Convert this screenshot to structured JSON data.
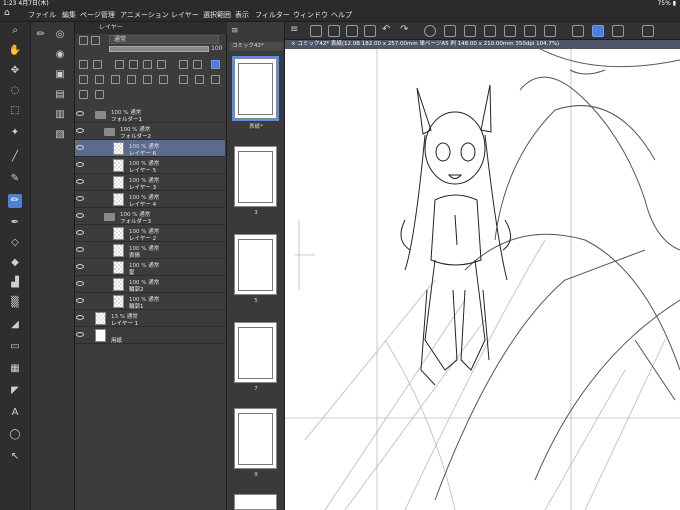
{
  "status": {
    "time": "1:23",
    "date": "4月7日(木)",
    "battery": "75%"
  },
  "menu": [
    "ファイル",
    "編集",
    "ページ管理",
    "アニメーション",
    "レイヤー",
    "選択範囲",
    "表示",
    "フィルター",
    "ウィンドウ",
    "ヘルプ"
  ],
  "layer_panel": {
    "title": "レイヤー",
    "blend_mode": "通常",
    "opacity": "100",
    "layers": [
      {
        "pct": "100 % 通常",
        "name": "フォルダー1",
        "type": "folder",
        "indent": 0
      },
      {
        "pct": "100 % 通常",
        "name": "フォルダー2",
        "type": "folder",
        "indent": 1
      },
      {
        "pct": "100 % 通常",
        "name": "レイヤー 6",
        "type": "layer",
        "indent": 2,
        "selected": true
      },
      {
        "pct": "100 % 通常",
        "name": "レイヤー 5",
        "type": "layer",
        "indent": 2
      },
      {
        "pct": "100 % 通常",
        "name": "レイヤー 3",
        "type": "layer",
        "indent": 2
      },
      {
        "pct": "100 % 通常",
        "name": "レイヤー 4",
        "type": "layer",
        "indent": 2
      },
      {
        "pct": "100 % 通常",
        "name": "フォルダー3",
        "type": "folder",
        "indent": 1
      },
      {
        "pct": "100 % 通常",
        "name": "レイヤー 2",
        "type": "layer",
        "indent": 2
      },
      {
        "pct": "100 % 通常",
        "name": "表情",
        "type": "layer",
        "indent": 2
      },
      {
        "pct": "100 % 通常",
        "name": "髪",
        "type": "layer",
        "indent": 2
      },
      {
        "pct": "100 % 通常",
        "name": "輪郭2",
        "type": "layer",
        "indent": 2
      },
      {
        "pct": "100 % 通常",
        "name": "輪郭1",
        "type": "layer",
        "indent": 2
      },
      {
        "pct": "13 % 通常",
        "name": "レイヤー 1",
        "type": "layer",
        "indent": 0
      },
      {
        "pct": "",
        "name": "用紙",
        "type": "paper",
        "indent": 0
      }
    ]
  },
  "page_panel": {
    "tab": "コミック42*",
    "pages": [
      {
        "num": "表紙*"
      },
      {
        "num": "3"
      },
      {
        "num": "5"
      },
      {
        "num": "7"
      },
      {
        "num": "9"
      }
    ]
  },
  "document_tab": "× コミック42* 表紙(12.0B 182.00 x 257.00mm 単ページA5 判 148.00 x 210.00mm 350dpi 104.7%)",
  "colors": {
    "accent": "#4d7fd6",
    "selected_layer": "#5b6a8e"
  }
}
